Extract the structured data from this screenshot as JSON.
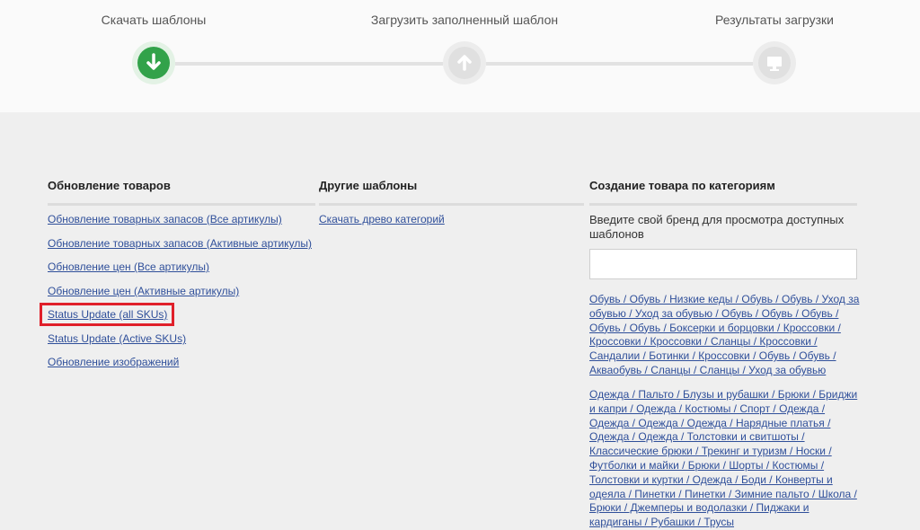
{
  "stepper": {
    "steps": [
      {
        "label": "Скачать шаблоны",
        "state": "active",
        "icon": "download-arrow-icon"
      },
      {
        "label": "Загрузить заполненный шаблон",
        "state": "inactive",
        "icon": "upload-arrow-icon"
      },
      {
        "label": "Результаты загрузки",
        "state": "inactive",
        "icon": "monitor-icon"
      }
    ],
    "colors": {
      "active": "#32a24a",
      "inactive": "#e0e0e0"
    }
  },
  "product_update": {
    "title": "Обновление товаров",
    "links": [
      "Обновление товарных запасов (Все артикулы)",
      "Обновление товарных запасов (Активные артикулы)",
      "Обновление цен (Все артикулы)",
      "Обновление цен (Активные артикулы)",
      "Status Update (all SKUs)",
      "Status Update (Active SKUs)",
      "Обновление изображений"
    ],
    "highlighted_link": "Status Update (all SKUs)",
    "highlight_color": "#e0202a"
  },
  "other_templates": {
    "title": "Другие шаблоны",
    "links": [
      "Скачать древо категорий"
    ]
  },
  "create_by_category": {
    "title": "Создание товара по категориям",
    "prompt": "Введите свой бренд для просмотра доступных шаблонов",
    "brand_input_value": "",
    "category_groups": [
      "Обувь / Обувь / Низкие кеды / Обувь / Обувь / Уход за обувью / Уход за обувью / Обувь / Обувь / Обувь / Обувь / Обувь / Боксерки и борцовки / Кроссовки / Кроссовки / Кроссовки / Сланцы / Кроссовки / Сандалии / Ботинки / Кроссовки / Обувь / Обувь / Аквaобувь / Сланцы / Сланцы / Уход за обувью",
      "Одежда / Пальто / Блузы и рубашки / Брюки / Бриджи и капри / Одежда / Костюмы / Спорт / Одежда / Одежда / Одежда / Одежда / Нарядные платья / Одежда / Одежда / Толстовки и свитшоты / Классические брюки / Трекинг и туризм / Носки / Футболки и майки / Брюки / Шорты / Костюмы / Толстовки и куртки / Одежда / Боди / Конверты и одеяла / Пинетки / Пинетки / Зимние пальто / Школа / Брюки / Джемперы и водолазки / Пиджаки и кардиганы / Рубашки / Трусы"
    ]
  }
}
